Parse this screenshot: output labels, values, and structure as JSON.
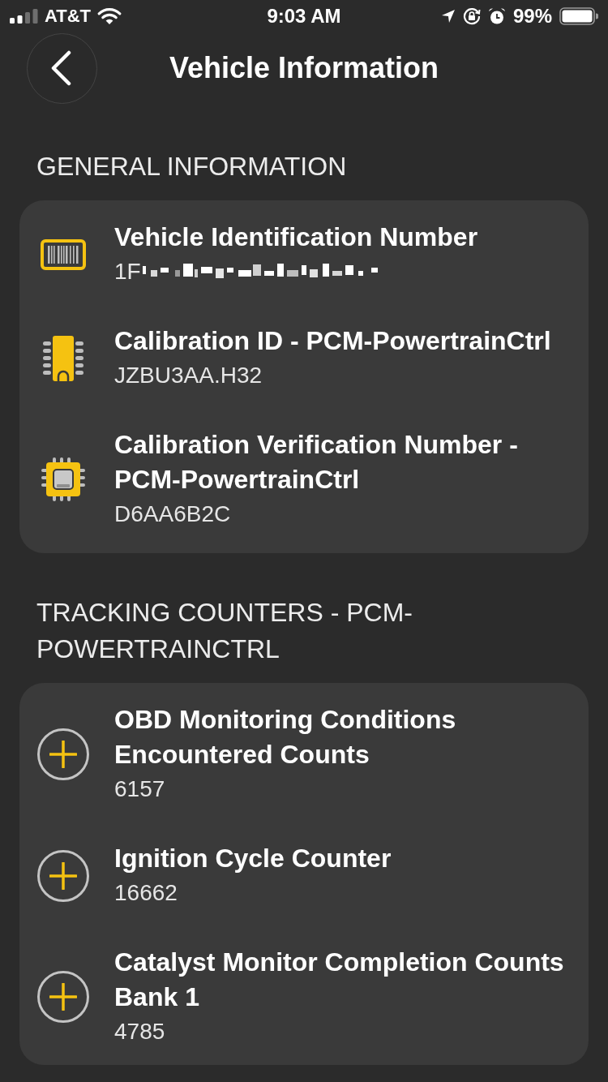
{
  "status_bar": {
    "carrier": "AT&T",
    "time": "9:03 AM",
    "battery": "99%"
  },
  "header": {
    "title": "Vehicle Information"
  },
  "sections": [
    {
      "heading": "GENERAL INFORMATION",
      "items": [
        {
          "kind": "barcode",
          "title": "Vehicle Identification Number",
          "value": "1F",
          "redacted": true
        },
        {
          "kind": "chip",
          "title": "Calibration ID - PCM-PowertrainCtrl",
          "value": "JZBU3AA.H32",
          "redacted": false
        },
        {
          "kind": "processor",
          "title": "Calibration Verification Number - PCM-PowertrainCtrl",
          "value": "D6AA6B2C",
          "redacted": false
        }
      ]
    },
    {
      "heading": "TRACKING COUNTERS - PCM-POWERTRAINCTRL",
      "items": [
        {
          "kind": "expand",
          "title": "OBD Monitoring Conditions Encountered Counts",
          "value": "6157",
          "redacted": false
        },
        {
          "kind": "expand",
          "title": "Ignition Cycle Counter",
          "value": "16662",
          "redacted": false
        },
        {
          "kind": "expand",
          "title": "Catalyst Monitor Completion Counts Bank 1",
          "value": "4785",
          "redacted": false
        }
      ]
    }
  ]
}
